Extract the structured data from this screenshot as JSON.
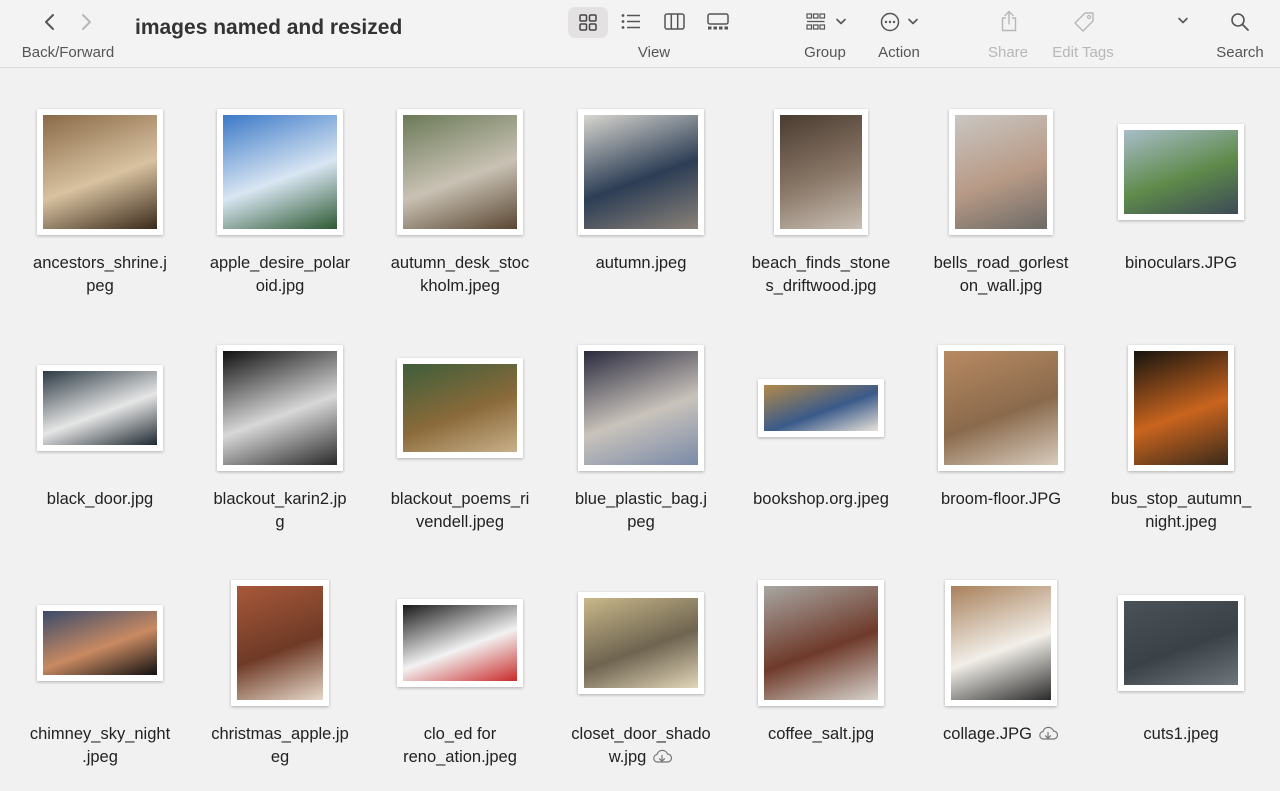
{
  "window": {
    "title": "images named and resized"
  },
  "toolbar": {
    "back_forward_label": "Back/Forward",
    "view_label": "View",
    "group_label": "Group",
    "action_label": "Action",
    "share_label": "Share",
    "edit_tags_label": "Edit Tags",
    "search_label": "Search"
  },
  "files": [
    {
      "name": "ancestors_shrine.j\npeg",
      "cloud": false,
      "colors": [
        "#8a6a48",
        "#d8c2a0",
        "#3a2a1a"
      ]
    },
    {
      "name": "apple_desire_polar\noid.jpg",
      "cloud": false,
      "colors": [
        "#3b79c7",
        "#d9e6f3",
        "#2e5a33"
      ]
    },
    {
      "name": "autumn_desk_stoc\nkholm.jpeg",
      "cloud": false,
      "colors": [
        "#6b7a58",
        "#c9c2b4",
        "#5a4632"
      ]
    },
    {
      "name": "autumn.jpeg",
      "cloud": false,
      "colors": [
        "#d8d6cf",
        "#2c3d55",
        "#8a8278"
      ]
    },
    {
      "name": "beach_finds_stone\ns_driftwood.jpg",
      "cloud": false,
      "colors": [
        "#4a3b30",
        "#8a7868",
        "#c9bfb4"
      ]
    },
    {
      "name": "bells_road_gorlest\non_wall.jpg",
      "cloud": false,
      "colors": [
        "#c9c6c2",
        "#b89a86",
        "#6d6a66"
      ]
    },
    {
      "name": "binoculars.JPG",
      "cloud": false,
      "colors": [
        "#a8bdc9",
        "#5e8a4a",
        "#3c4a56"
      ]
    },
    {
      "name": "black_door.jpg",
      "cloud": false,
      "colors": [
        "#2c3a44",
        "#e6e6e6",
        "#1d2830"
      ]
    },
    {
      "name": "blackout_karin2.jp\ng",
      "cloud": false,
      "colors": [
        "#111111",
        "#d8d8d8",
        "#2a2a2a"
      ]
    },
    {
      "name": "blackout_poems_ri\nvendell.jpeg",
      "cloud": false,
      "colors": [
        "#3e5e3a",
        "#8a6a3a",
        "#c9b08a"
      ]
    },
    {
      "name": "blue_plastic_bag.j\npeg",
      "cloud": false,
      "colors": [
        "#2a2a3e",
        "#c9c3bb",
        "#7a8aa8"
      ]
    },
    {
      "name": "bookshop.org.jpeg",
      "cloud": false,
      "colors": [
        "#b28a4a",
        "#3a5a8a",
        "#e8e2d8"
      ]
    },
    {
      "name": "broom-floor.JPG",
      "cloud": false,
      "colors": [
        "#b88a62",
        "#8a6a4c",
        "#d8cbbd"
      ]
    },
    {
      "name": "bus_stop_autumn_\nnight.jpeg",
      "cloud": false,
      "colors": [
        "#16140f",
        "#c9641e",
        "#3a2a1a"
      ]
    },
    {
      "name": "chimney_sky_night\n.jpeg",
      "cloud": false,
      "colors": [
        "#3a4a6a",
        "#c98a62",
        "#111111"
      ]
    },
    {
      "name": "christmas_apple.jp\neg",
      "cloud": false,
      "colors": [
        "#a8583a",
        "#6e3a26",
        "#e6d8c9"
      ]
    },
    {
      "name": "clo_ed for\nreno_ation.jpeg",
      "cloud": false,
      "colors": [
        "#1a1a1a",
        "#f2f2f2",
        "#c92a2a"
      ]
    },
    {
      "name": "closet_door_shado\nw.jpg",
      "cloud": true,
      "colors": [
        "#c9b88a",
        "#6e6450",
        "#e2d6b8"
      ]
    },
    {
      "name": "coffee_salt.jpg",
      "cloud": false,
      "colors": [
        "#a8a6a2",
        "#6e3a2a",
        "#d8d4ce"
      ]
    },
    {
      "name": "collage.JPG",
      "cloud": true,
      "colors": [
        "#a8805a",
        "#f2efe9",
        "#2a2a2a"
      ]
    },
    {
      "name": "cuts1.jpeg",
      "cloud": false,
      "colors": [
        "#4a5258",
        "#3a4248",
        "#6e767c"
      ]
    }
  ]
}
